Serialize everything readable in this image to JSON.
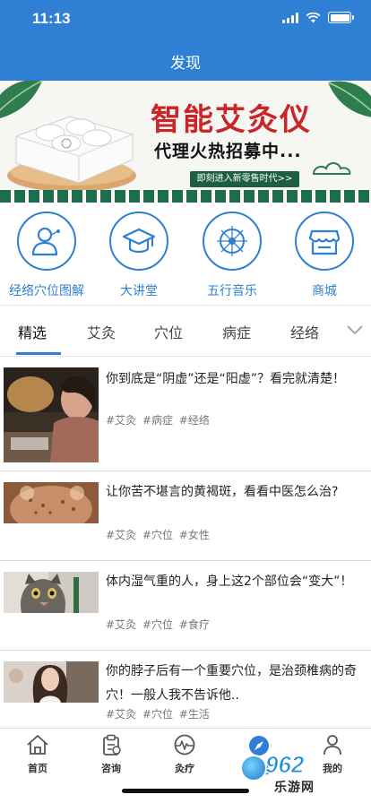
{
  "status_bar": {
    "time": "11:13"
  },
  "header": {
    "title": "发现"
  },
  "banner": {
    "title": "智能艾灸仪",
    "subtitle": "代理火热招募中...",
    "cta": "即刻进入新零售时代>>"
  },
  "quick_nav": [
    {
      "label": "经络穴位图解",
      "icon": "person-icon"
    },
    {
      "label": "大讲堂",
      "icon": "graduation-cap-icon"
    },
    {
      "label": "五行音乐",
      "icon": "music-circle-icon"
    },
    {
      "label": "商城",
      "icon": "shop-icon"
    }
  ],
  "tabs": [
    {
      "label": "精选",
      "active": true
    },
    {
      "label": "艾灸"
    },
    {
      "label": "穴位"
    },
    {
      "label": "病症"
    },
    {
      "label": "经络"
    }
  ],
  "articles": [
    {
      "title": "你到底是“阴虚”还是“阳虚”？看完就清楚！",
      "tags": [
        "#艾灸",
        "#病症",
        "#经络"
      ]
    },
    {
      "title": "让你苦不堪言的黄褐斑，看看中医怎么治?",
      "tags": [
        "#艾灸",
        "#穴位",
        "#女性"
      ]
    },
    {
      "title": "体内湿气重的人，身上这2个部位会“变大”！",
      "tags": [
        "#艾灸",
        "#穴位",
        "#食疗"
      ]
    },
    {
      "title": "你的脖子后有一个重要穴位，是治颈椎病的奇穴！一般人我不告诉他..",
      "tags": [
        "#艾灸",
        "#穴位",
        "#生活"
      ]
    }
  ],
  "tabbar": [
    {
      "label": "首页",
      "icon": "home-icon"
    },
    {
      "label": "咨询",
      "icon": "clipboard-icon"
    },
    {
      "label": "灸疗",
      "icon": "pulse-icon"
    },
    {
      "label": "发现",
      "icon": "compass-icon",
      "active": true
    },
    {
      "label": "我的",
      "icon": "user-icon"
    }
  ],
  "watermark": {
    "number": "962",
    "text": "乐游网"
  },
  "colors": {
    "primary": "#2f7fd4",
    "banner_red": "#c9262a",
    "banner_green": "#1d5e45"
  }
}
